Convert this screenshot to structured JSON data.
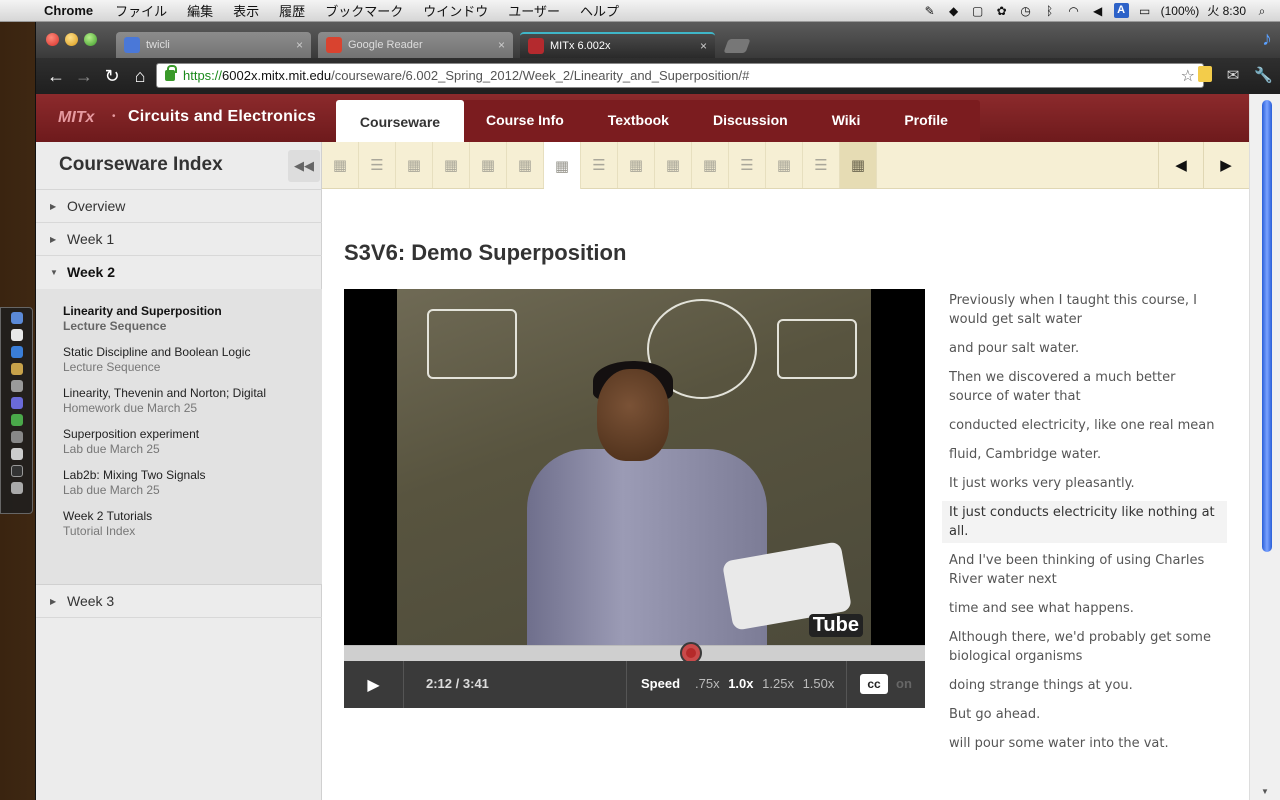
{
  "menubar": {
    "app_name": "Chrome",
    "menus": [
      "ファイル",
      "編集",
      "表示",
      "履歴",
      "ブックマーク",
      "ウインドウ",
      "ユーザー",
      "ヘルプ"
    ],
    "battery": "(100%)",
    "clock": "火 8:30",
    "input_badge": "A"
  },
  "browser": {
    "tabs": [
      {
        "title": "twicli",
        "favicon_color": "#4a78d8"
      },
      {
        "title": "Google Reader",
        "favicon_color": "#d9432f"
      },
      {
        "title": "MITx 6.002x",
        "favicon_color": "#b42a2e"
      }
    ],
    "url": {
      "protocol": "https://",
      "host": "6002x.mitx.mit.edu",
      "path": "/courseware/6.002_Spring_2012/Week_2/Linearity_and_Superposition/#"
    }
  },
  "header": {
    "brand": "MITx",
    "course_title": "Circuits and Electronics",
    "accent_color": "#8c2a2c",
    "nav": [
      "Courseware",
      "Course Info",
      "Textbook",
      "Discussion",
      "Wiki",
      "Profile"
    ]
  },
  "sidebar": {
    "title": "Courseware Index",
    "chapters": [
      {
        "label": "Overview",
        "open": false
      },
      {
        "label": "Week 1",
        "open": false
      },
      {
        "label": "Week 2",
        "open": true
      },
      {
        "label": "Week 3",
        "open": false
      }
    ],
    "sections": [
      {
        "name": "Linearity and Superposition",
        "sub": "Lecture Sequence",
        "active": true
      },
      {
        "name": "Static Discipline and Boolean Logic",
        "sub": "Lecture Sequence",
        "active": false
      },
      {
        "name": "Linearity, Thevenin and Norton; Digital",
        "sub": "Homework due March 25",
        "active": false
      },
      {
        "name": "Superposition experiment",
        "sub": "Lab due March 25",
        "active": false
      },
      {
        "name": "Lab2b: Mixing Two Signals",
        "sub": "Lab due March 25",
        "active": false
      },
      {
        "name": "Week 2 Tutorials",
        "sub": "Tutorial Index",
        "active": false
      }
    ]
  },
  "sequence": {
    "items": [
      "video",
      "list",
      "video",
      "video",
      "video",
      "video",
      "video",
      "list",
      "video",
      "video",
      "video",
      "list",
      "video",
      "list",
      "video"
    ],
    "active_index": 6,
    "visited_index": 14
  },
  "unit": {
    "title": "S3V6: Demo Superposition"
  },
  "video": {
    "current_time": "2:12",
    "duration": "3:41",
    "progress": 0.5973,
    "speed_label": "Speed",
    "speeds": [
      ".75x",
      "1.0x",
      "1.25x",
      "1.50x"
    ],
    "current_speed": "1.0x",
    "cc_label": "cc",
    "cc_state": "on",
    "watermark": "Tube"
  },
  "transcript": {
    "current_index": 6,
    "lines": [
      "Previously when I taught this course, I would get salt water",
      "and pour salt water.",
      "Then we discovered a much better source of water that",
      "conducted electricity, like one real mean",
      "fluid, Cambridge water.",
      "It just works very pleasantly.",
      "It just conducts electricity like nothing at all.",
      "And I've been thinking of using Charles River water next",
      "time and see what happens.",
      "Although there, we'd probably get some biological organisms",
      "doing strange things at you.",
      "But go ahead.",
      "will pour some water into the vat."
    ]
  }
}
